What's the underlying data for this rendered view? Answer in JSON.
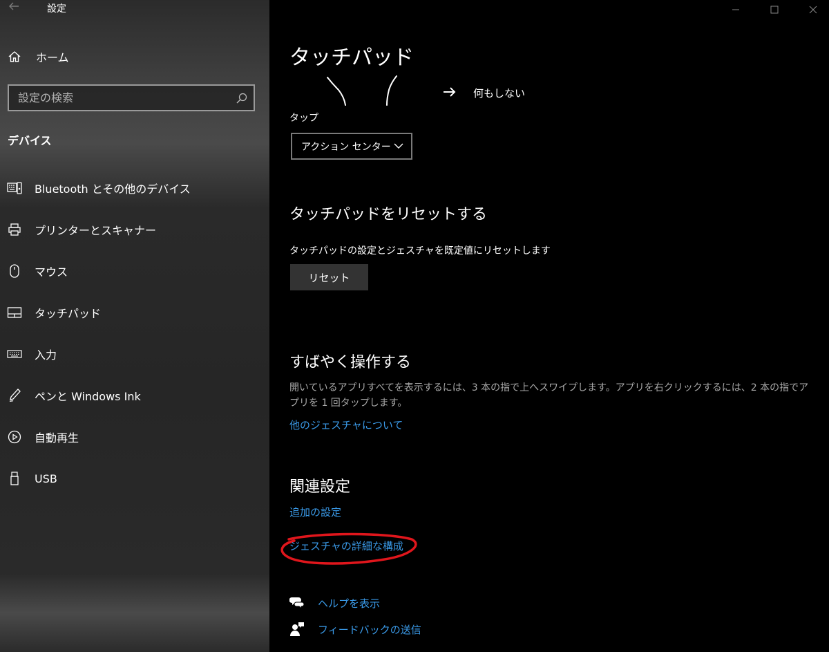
{
  "window": {
    "title": "設定",
    "back_icon": "back-arrow-icon",
    "controls": [
      "minimize-icon",
      "maximize-icon",
      "close-icon"
    ]
  },
  "sidebar": {
    "home_label": "ホーム",
    "search_placeholder": "設定の検索",
    "section": "デバイス",
    "items": [
      {
        "label": "Bluetooth とその他のデバイス",
        "icon": "bluetooth-devices-icon"
      },
      {
        "label": "プリンターとスキャナー",
        "icon": "printer-icon"
      },
      {
        "label": "マウス",
        "icon": "mouse-icon"
      },
      {
        "label": "タッチパッド",
        "icon": "touchpad-icon"
      },
      {
        "label": "入力",
        "icon": "keyboard-icon"
      },
      {
        "label": "ペンと Windows Ink",
        "icon": "pen-icon"
      },
      {
        "label": "自動再生",
        "icon": "autoplay-icon"
      },
      {
        "label": "USB",
        "icon": "usb-icon"
      }
    ]
  },
  "main": {
    "title": "タッチパッド",
    "gesture_result": "何もしない",
    "tap_label": "タップ",
    "tap_value": "アクション センター",
    "reset": {
      "heading": "タッチパッドをリセットする",
      "description": "タッチパッドの設定とジェスチャを既定値にリセットします",
      "button": "リセット"
    },
    "quick": {
      "heading": "すばやく操作する",
      "description": "開いているアプリすべてを表示するには、3 本の指で上へスワイプします。アプリを右クリックするには、2 本の指でアプリを 1 回タップします。",
      "link": "他のジェスチャについて"
    },
    "related": {
      "heading": "関連設定",
      "additional_link": "追加の設定",
      "advanced_link": "ジェスチャの詳細な構成"
    },
    "help": {
      "help_label": "ヘルプを表示",
      "feedback_label": "フィードバックの送信"
    }
  },
  "colors": {
    "link": "#3a9ae8",
    "annotation": "#e0161c",
    "background": "#000000"
  }
}
